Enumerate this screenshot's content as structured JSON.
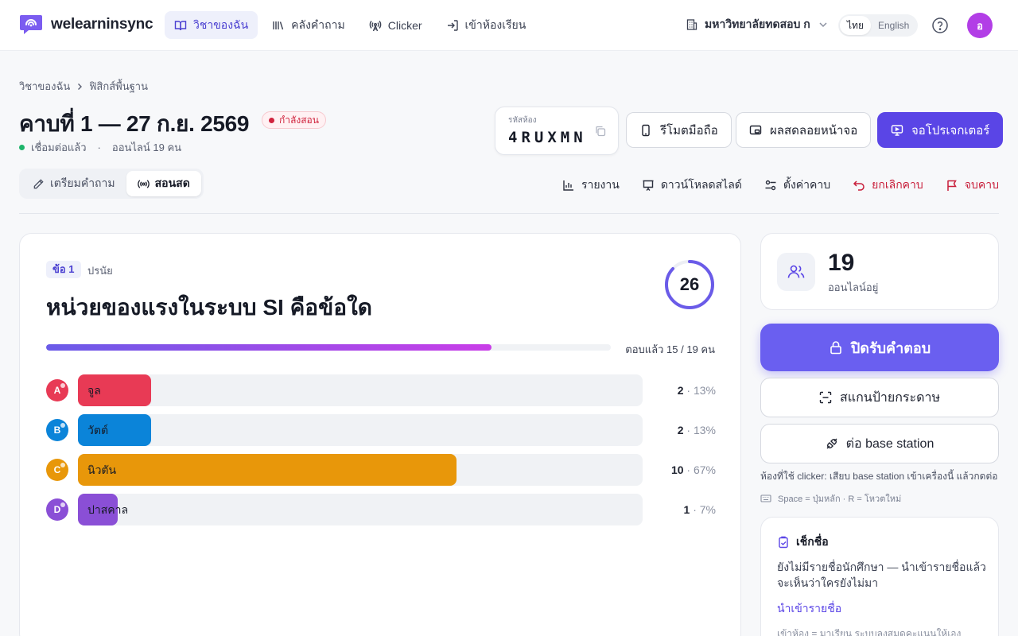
{
  "app": {
    "brand": "welearninsync",
    "nav": [
      {
        "label": "วิชาของฉัน",
        "icon": "book-icon",
        "active": true
      },
      {
        "label": "คลังคำถาม",
        "icon": "library-icon",
        "active": false
      },
      {
        "label": "Clicker",
        "icon": "antenna-icon",
        "active": false
      },
      {
        "label": "เข้าห้องเรียน",
        "icon": "login-icon",
        "active": false
      }
    ],
    "university": "มหาวิทยาลัยทดสอบ ก",
    "languages": [
      "ไทย",
      "English"
    ],
    "avatar_initial": "อ"
  },
  "breadcrumb": [
    "วิชาของฉัน",
    "ฟิสิกส์พื้นฐาน"
  ],
  "session": {
    "title": "คาบที่ 1 — 27 ก.ย. 2569",
    "badge": "กำลังสอน",
    "connected": "เชื่อมต่อแล้ว",
    "separator": "·",
    "online_text": "ออนไลน์ 19 คน",
    "room_code_label": "รหัสห้อง",
    "room_code": "4RUXMN"
  },
  "header_buttons": {
    "remote": "รีโมตมือถือ",
    "live_results": "ผลสดลอยหน้าจอ",
    "projector": "จอโปรเจกเตอร์"
  },
  "mode_tabs": [
    {
      "label": "เตรียมคำถาม",
      "icon": "pencil-icon",
      "active": false
    },
    {
      "label": "สอนสด",
      "icon": "broadcast-icon",
      "active": true
    }
  ],
  "actions": [
    {
      "label": "รายงาน",
      "icon": "bar-chart-icon",
      "danger": false
    },
    {
      "label": "ดาวน์โหลดสไลด์",
      "icon": "presentation-icon",
      "danger": false
    },
    {
      "label": "ตั้งค่าคาบ",
      "icon": "settings-icon",
      "danger": false
    },
    {
      "label": "ยกเลิกคาบ",
      "icon": "undo-icon",
      "danger": true
    },
    {
      "label": "จบคาบ",
      "icon": "flag-icon",
      "danger": true
    }
  ],
  "question": {
    "number": "ข้อ 1",
    "type": "ปรนัย",
    "text": "หน่วยของแรงในระบบ SI คือข้อใด",
    "timer": "26",
    "timer_fraction": 0.87,
    "answered_text": "ตอบแล้ว 15 / 19 คน",
    "answered_fraction": 0.789,
    "options": [
      {
        "letter": "A",
        "label": "จูล",
        "count": "2",
        "pct": "· 13%",
        "share": 0.13,
        "color": "#e83a55"
      },
      {
        "letter": "B",
        "label": "วัตต์",
        "count": "2",
        "pct": "· 13%",
        "share": 0.13,
        "color": "#0b84d9"
      },
      {
        "letter": "C",
        "label": "นิวตัน",
        "count": "10",
        "pct": "· 67%",
        "share": 0.67,
        "color": "#e8970a"
      },
      {
        "letter": "D",
        "label": "ปาสคาล",
        "count": "1",
        "pct": "· 7%",
        "share": 0.07,
        "color": "#8a4fd6"
      }
    ]
  },
  "sidebar": {
    "online_count": "19",
    "online_label": "ออนไลน์อยู่",
    "close_button": "ปิดรับคำตอบ",
    "scan_button": "สแกนป้ายกระดาษ",
    "base_button": "ต่อ base station",
    "clicker_hint": "ห้องที่ใช้ clicker: เสียบ base station เข้าเครื่องนี้ แล้วกดต่อ",
    "keys_hint": "Space = ปุ่มหลัก · R = โหวตใหม่",
    "roll": {
      "title": "เช็กชื่อ",
      "desc": "ยังไม่มีรายชื่อนักศึกษา — นำเข้ารายชื่อแล้วจะเห็นว่าใครยังไม่มา",
      "link": "นำเข้ารายชื่อ",
      "foot": "เข้าห้อง = มาเรียน ระบบลงสมุดคะแนนให้เอง"
    }
  },
  "colors": {
    "accent": "#5a45e6",
    "close_button": "#6a5ff0",
    "danger": "#c81e3a",
    "online_green": "#1db46a"
  }
}
